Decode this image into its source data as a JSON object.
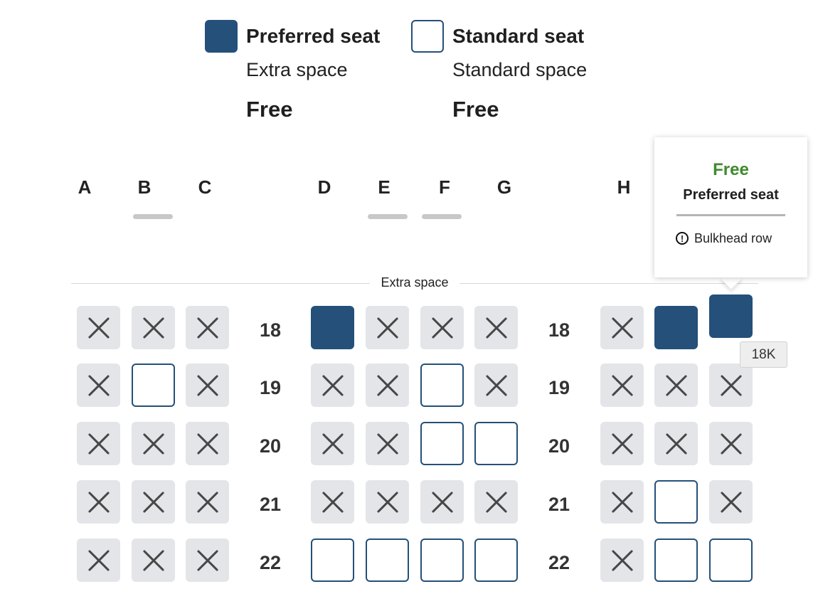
{
  "legend": [
    {
      "type": "preferred",
      "title": "Preferred seat",
      "description": "Extra space",
      "price": "Free"
    },
    {
      "type": "standard",
      "title": "Standard seat",
      "description": "Standard space",
      "price": "Free"
    }
  ],
  "columns": [
    "A",
    "B",
    "C",
    "D",
    "E",
    "F",
    "G",
    "H"
  ],
  "section_label": "Extra space",
  "rows": [
    {
      "number": "18",
      "seats": [
        "blocked",
        "blocked",
        "blocked",
        "preferred",
        "blocked",
        "blocked",
        "blocked",
        "blocked",
        "preferred",
        "preferred"
      ]
    },
    {
      "number": "19",
      "seats": [
        "blocked",
        "standard",
        "blocked",
        "blocked",
        "blocked",
        "standard",
        "blocked",
        "blocked",
        "blocked",
        "blocked"
      ]
    },
    {
      "number": "20",
      "seats": [
        "blocked",
        "blocked",
        "blocked",
        "blocked",
        "blocked",
        "standard",
        "standard",
        "blocked",
        "blocked",
        "blocked"
      ]
    },
    {
      "number": "21",
      "seats": [
        "blocked",
        "blocked",
        "blocked",
        "blocked",
        "blocked",
        "blocked",
        "blocked",
        "blocked",
        "standard",
        "blocked"
      ]
    },
    {
      "number": "22",
      "seats": [
        "blocked",
        "blocked",
        "blocked",
        "standard",
        "standard",
        "standard",
        "standard",
        "blocked",
        "standard",
        "standard"
      ]
    }
  ],
  "tooltip": {
    "price": "Free",
    "seat_type": "Preferred seat",
    "note": "Bulkhead row",
    "note_icon": "info-icon"
  },
  "hover_seat_label": "18K",
  "colors": {
    "preferred": "#24507a",
    "blocked": "#e3e5e8",
    "price_green": "#3e8a2e"
  }
}
